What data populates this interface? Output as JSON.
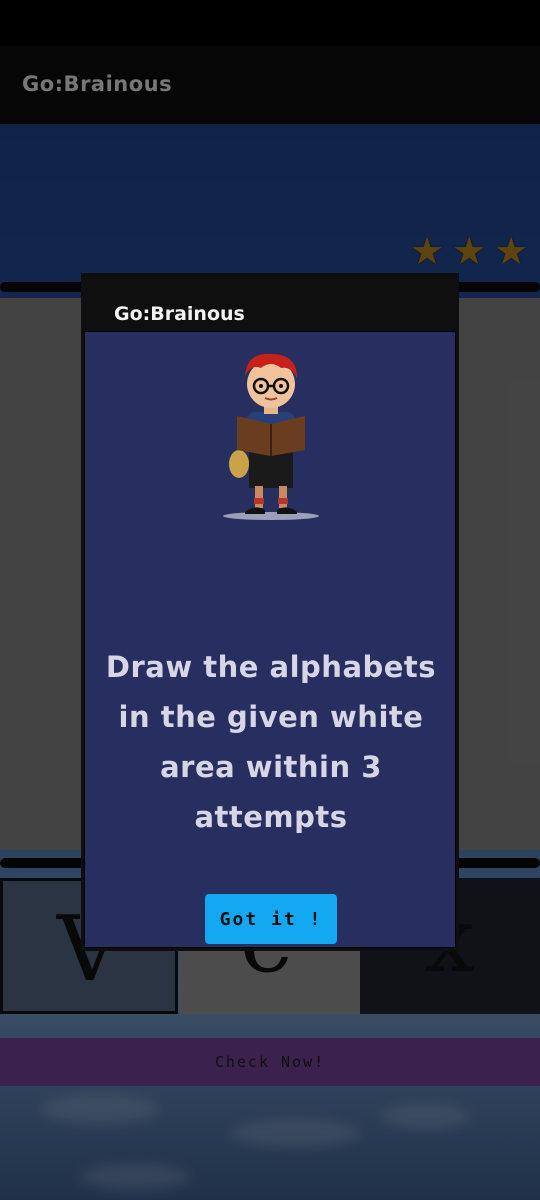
{
  "app": {
    "title": "Go:Brainous"
  },
  "rating": {
    "stars": 3
  },
  "tiles": [
    {
      "letter": "V"
    },
    {
      "letter": "e"
    },
    {
      "letter": "x"
    }
  ],
  "check_button": {
    "label": "Check Now!"
  },
  "dialog": {
    "title": "Go:Brainous",
    "message": "Draw the alphabets in the given white area within 3 attempts",
    "button_label": "Got it !"
  },
  "colors": {
    "app_bar": "#0b0b0b",
    "dialog_body": "#262f60",
    "got_it_button": "#14a8f2",
    "check_button": "#6b3f8c",
    "star": "#a97a1d"
  }
}
